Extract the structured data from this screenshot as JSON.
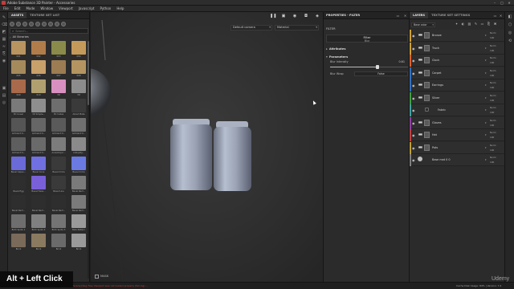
{
  "app": {
    "window_title": "Adobe Substance 3D Painter - Accessories"
  },
  "menu": [
    "File",
    "Edit",
    "Mode",
    "Window",
    "Viewport",
    "Javascript",
    "Python",
    "Help"
  ],
  "assets": {
    "tabs": [
      "ASSETS",
      "TEXTURE SET LIST"
    ],
    "search_placeholder": "Search...",
    "library_label": "All libraries",
    "items": [
      {
        "label": "001",
        "color": "#b89460"
      },
      {
        "label": "002",
        "color": "#b07c4a"
      },
      {
        "label": "003",
        "color": "#8a8a4a"
      },
      {
        "label": "004",
        "color": "#c49a5a"
      },
      {
        "label": "005",
        "color": "#a58a5c"
      },
      {
        "label": "006",
        "color": "#c8a06a"
      },
      {
        "label": "007",
        "color": "#9c7c52"
      },
      {
        "label": "008",
        "color": "#b49460"
      },
      {
        "label": "009",
        "color": "#a86a4a"
      },
      {
        "label": "010",
        "color": "#b0a070"
      },
      {
        "label": "3D",
        "color": "#d890c0"
      },
      {
        "label": "3D",
        "color": "#8c8c8c"
      },
      {
        "label": "3D Linear",
        "color": "#7a7a7a"
      },
      {
        "label": "3D Simple...",
        "color": "#8e8e8e"
      },
      {
        "label": "3D Cubes",
        "color": "#6e6e6e"
      },
      {
        "label": "About Plate",
        "color": "#3a3a3a"
      },
      {
        "label": "Ambient O...",
        "color": "#555555"
      },
      {
        "label": "Ambient O...",
        "color": "#666666"
      },
      {
        "label": "Ambient O...",
        "color": "#5a5a5a"
      },
      {
        "label": "Ambient O...",
        "color": "#707070"
      },
      {
        "label": "Ambient O...",
        "color": "#5e5e5e"
      },
      {
        "label": "Ambient O...",
        "color": "#6a6a6a"
      },
      {
        "label": "Anisotropic...",
        "color": "#7c7c7c"
      },
      {
        "label": "Antiquity...",
        "color": "#8a8a8a"
      },
      {
        "label": "Bevel Capsu...",
        "color": "#6a6ad8"
      },
      {
        "label": "Bevel Cone",
        "color": "#7070e0"
      },
      {
        "label": "Bevel Circle",
        "color": "#3a3a3a"
      },
      {
        "label": "Bevel Circle",
        "color": "#6a7ae0"
      },
      {
        "label": "Bevel Egg",
        "color": "#2e2e2e"
      },
      {
        "label": "Bevel Hexa...",
        "color": "#7a60d8"
      },
      {
        "label": "Bevel Line",
        "color": "#3a3a3a"
      },
      {
        "label": "Bevel Rect...",
        "color": "#7a7a7a"
      },
      {
        "label": "Bevel Rect...",
        "color": "#2e2e2e"
      },
      {
        "label": "Bevel Rect...",
        "color": "#2e2e2e"
      },
      {
        "label": "Bevel Rect...",
        "color": "#2e2e2e"
      },
      {
        "label": "Bevel Rect...",
        "color": "#7a7a7a"
      },
      {
        "label": "Birth Spots 1",
        "color": "#6e6e6e"
      },
      {
        "label": "Birth Spots 2",
        "color": "#808080"
      },
      {
        "label": "Birth Spots 3",
        "color": "#747474"
      },
      {
        "label": "Blob Pattern",
        "color": "#9a9a9a"
      },
      {
        "label": "Brick",
        "color": "#7a6a5a"
      },
      {
        "label": "Brick",
        "color": "#8a7a60"
      },
      {
        "label": "Brick",
        "color": "#6a6a6a"
      },
      {
        "label": "Brick",
        "color": "#9a9a9a"
      }
    ]
  },
  "viewport": {
    "camera_select": "Default camera",
    "channel_select": "Material",
    "mode_label": "MASK"
  },
  "properties": {
    "header": "PROPERTIES - FILTER",
    "section": "FILTER",
    "filter_title": "Filter",
    "filter_name": "Blur",
    "group_attributes": "Attributes",
    "group_parameters": "Parameters",
    "blur_intensity_label": "Blur Intensity",
    "blur_intensity_value": "0.61",
    "blur_intensity_fraction": 0.61,
    "blur_wrap_label": "Blur Wrap",
    "blur_wrap_value": "False"
  },
  "layers": {
    "tabs": [
      "LAYERS",
      "TEXTURE SET SETTINGS"
    ],
    "blend_select": "Base color",
    "rows": [
      {
        "name": "Bronze",
        "color": "#d0a030",
        "blend": "Norm",
        "opacity": "100"
      },
      {
        "name": "Truck",
        "color": "#d0a030",
        "blend": "Norm",
        "opacity": "100"
      },
      {
        "name": "Clock",
        "color": "#e0602a",
        "blend": "Norm",
        "opacity": "100"
      },
      {
        "name": "Carpet",
        "color": "#3070c0",
        "blend": "Norm",
        "opacity": "100"
      },
      {
        "name": "Earrings",
        "color": "#3070c0",
        "blend": "Norm",
        "opacity": "100"
      },
      {
        "name": "Silver",
        "color": "#40a040",
        "blend": "Norm",
        "opacity": "100"
      },
      {
        "name": "Fabric",
        "color": "#40a0a0",
        "blend": "Norm",
        "opacity": "100"
      },
      {
        "name": "Gloves",
        "color": "#9040a0",
        "blend": "Norm",
        "opacity": "100"
      },
      {
        "name": "Hat",
        "color": "#c04040",
        "blend": "Norm",
        "opacity": "100"
      },
      {
        "name": "Pots",
        "color": "#c0a030",
        "blend": "Norm",
        "opacity": "100"
      },
      {
        "name": "Base mat 0 0",
        "color": "#808080",
        "blend": "Norm",
        "opacity": "100"
      }
    ]
  },
  "status": {
    "message": "[Scene] Nog Tree Viewport was not loaded properly (fail.log) ...",
    "cache": "Cache Disk Usage: 84% | Version: 7.4"
  },
  "overlay": {
    "caption": "Alt + Left Click",
    "watermark": "Udemy"
  }
}
